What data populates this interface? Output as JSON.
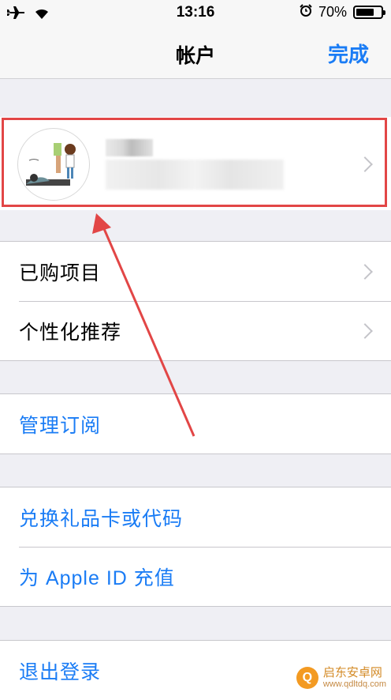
{
  "status": {
    "time": "13:16",
    "battery": "70%",
    "battery_level": 0.7
  },
  "nav": {
    "title": "帐户",
    "done": "完成"
  },
  "groups": {
    "g1": [
      "已购项目",
      "个性化推荐"
    ],
    "g2": [
      "管理订阅"
    ],
    "g3": [
      "兑换礼品卡或代码",
      "为 Apple ID 充值"
    ],
    "g4": [
      "退出登录"
    ]
  },
  "watermark": {
    "brand": "启东安卓网",
    "url": "www.qdltdq.com"
  }
}
